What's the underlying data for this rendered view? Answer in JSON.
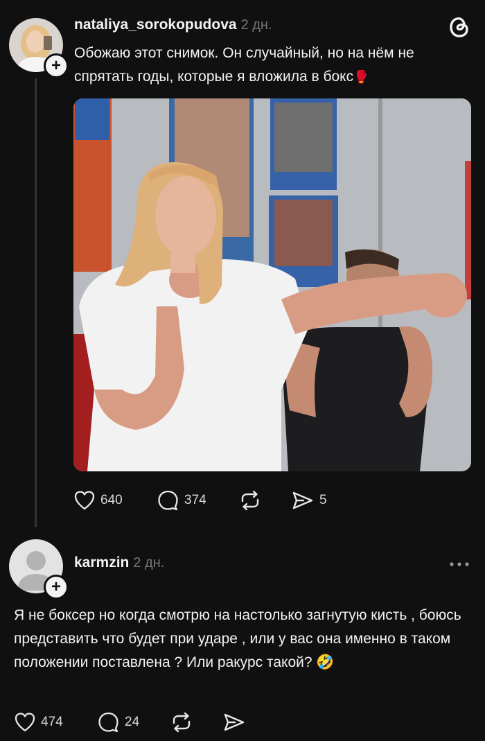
{
  "post": {
    "username": "nataliya_sorokopudova",
    "time": "2 дн.",
    "text": "Обожаю этот снимок. Он случайный, но на нём не спрятать годы, которые я вложила в бокс",
    "emoji": "🥊",
    "likes": "640",
    "comments": "374",
    "shares": "5"
  },
  "reply": {
    "username": "karmzin",
    "time": "2 дн.",
    "text": "Я не боксер но когда смотрю на настолько загнутую кисть , боюсь представить что будет при ударе , или у вас она именно в таком положении поставлена ? Или ракурс такой?",
    "emoji": "🤣",
    "likes": "474",
    "comments": "24"
  },
  "icons": {
    "threads": "threads-logo",
    "like": "heart-icon",
    "comment": "comment-icon",
    "repost": "repost-icon",
    "share": "share-icon",
    "more": "more-icon"
  }
}
